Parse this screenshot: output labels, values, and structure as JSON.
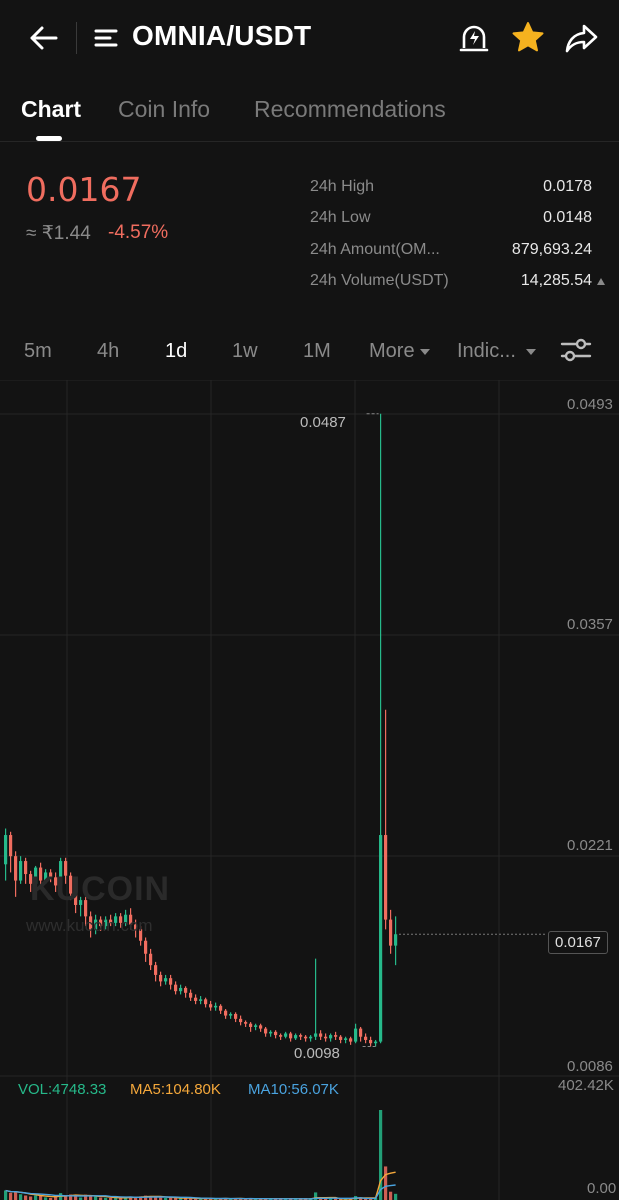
{
  "header": {
    "title": "OMNIA/USDT",
    "icons": [
      "back-arrow-icon",
      "menu-icon",
      "price-alert-icon",
      "star-icon",
      "share-icon"
    ],
    "star_color": "#f5b21f"
  },
  "tabs": [
    {
      "label": "Chart",
      "active": true
    },
    {
      "label": "Coin Info",
      "active": false
    },
    {
      "label": "Recommendations",
      "active": false
    }
  ],
  "price": {
    "last": "0.0167",
    "inr": "≈ ₹1.44",
    "change": "-4.57%",
    "color": "#f06d5f"
  },
  "stats": [
    {
      "label": "24h High",
      "value": "0.0178"
    },
    {
      "label": "24h Low",
      "value": "0.0148"
    },
    {
      "label": "24h Amount(OM...",
      "value": "879,693.24"
    },
    {
      "label": "24h Volume(USDT)",
      "value": "14,285.54"
    }
  ],
  "timeframes": [
    {
      "label": "5m",
      "active": false
    },
    {
      "label": "4h",
      "active": false
    },
    {
      "label": "1d",
      "active": true
    },
    {
      "label": "1w",
      "active": false
    },
    {
      "label": "1M",
      "active": false
    }
  ],
  "more_label": "More",
  "indicators_label": "Indic...",
  "chart_data": {
    "type": "candlestick",
    "y_axis_ticks": [
      "0.0493",
      "0.0357",
      "0.0221",
      "0.0086"
    ],
    "max_marker": "0.0487",
    "min_marker": "0.0098",
    "current_price": "0.0167",
    "watermark": "KUCOIN",
    "watermark_url": "www.kucoin.com",
    "up_color": "#26b98a",
    "down_color": "#f06d5f",
    "candles": [
      [
        0.021,
        0.0228,
        0.0232,
        0.02
      ],
      [
        0.0228,
        0.0215,
        0.023,
        0.0205
      ],
      [
        0.0215,
        0.02,
        0.0218,
        0.019
      ],
      [
        0.02,
        0.0212,
        0.0215,
        0.0198
      ],
      [
        0.0212,
        0.0204,
        0.0214,
        0.0198
      ],
      [
        0.0204,
        0.0198,
        0.0206,
        0.0193
      ],
      [
        0.0198,
        0.0208,
        0.0209,
        0.0197
      ],
      [
        0.0208,
        0.02,
        0.0211,
        0.0196
      ],
      [
        0.02,
        0.0205,
        0.0207,
        0.0198
      ],
      [
        0.0205,
        0.0202,
        0.0207,
        0.0199
      ],
      [
        0.0202,
        0.0197,
        0.0205,
        0.0193
      ],
      [
        0.0197,
        0.0212,
        0.0214,
        0.0195
      ],
      [
        0.0212,
        0.0203,
        0.0214,
        0.0198
      ],
      [
        0.0203,
        0.0192,
        0.0205,
        0.0188
      ],
      [
        0.0192,
        0.0185,
        0.0195,
        0.018
      ],
      [
        0.0185,
        0.0188,
        0.019,
        0.0178
      ],
      [
        0.0188,
        0.0178,
        0.019,
        0.0172
      ],
      [
        0.0178,
        0.017,
        0.0181,
        0.0165
      ],
      [
        0.017,
        0.0176,
        0.0179,
        0.0167
      ],
      [
        0.0176,
        0.0172,
        0.0178,
        0.0169
      ],
      [
        0.0172,
        0.0176,
        0.0178,
        0.017
      ],
      [
        0.0176,
        0.0174,
        0.0179,
        0.0172
      ],
      [
        0.0174,
        0.0178,
        0.018,
        0.0172
      ],
      [
        0.0178,
        0.0174,
        0.018,
        0.0171
      ],
      [
        0.0174,
        0.0179,
        0.0182,
        0.0172
      ],
      [
        0.0179,
        0.0173,
        0.0183,
        0.017
      ],
      [
        0.0173,
        0.017,
        0.0176,
        0.0165
      ],
      [
        0.017,
        0.0163,
        0.0172,
        0.016
      ],
      [
        0.0163,
        0.0155,
        0.0165,
        0.015
      ],
      [
        0.0155,
        0.0148,
        0.0158,
        0.0145
      ],
      [
        0.0148,
        0.0142,
        0.015,
        0.0138
      ],
      [
        0.0142,
        0.0138,
        0.0144,
        0.0135
      ],
      [
        0.0138,
        0.014,
        0.0142,
        0.0136
      ],
      [
        0.014,
        0.0136,
        0.0142,
        0.0133
      ],
      [
        0.0136,
        0.0132,
        0.0138,
        0.013
      ],
      [
        0.0132,
        0.0134,
        0.0136,
        0.013
      ],
      [
        0.0134,
        0.0131,
        0.0135,
        0.0128
      ],
      [
        0.0131,
        0.0128,
        0.0133,
        0.0126
      ],
      [
        0.0128,
        0.0126,
        0.013,
        0.0124
      ],
      [
        0.0126,
        0.0127,
        0.0129,
        0.0124
      ],
      [
        0.0127,
        0.0124,
        0.0128,
        0.0122
      ],
      [
        0.0124,
        0.0122,
        0.0126,
        0.012
      ],
      [
        0.0122,
        0.0123,
        0.0125,
        0.012
      ],
      [
        0.0123,
        0.012,
        0.0124,
        0.0118
      ],
      [
        0.012,
        0.0117,
        0.0121,
        0.0115
      ],
      [
        0.0117,
        0.0118,
        0.0119,
        0.0115
      ],
      [
        0.0118,
        0.0115,
        0.0119,
        0.0113
      ],
      [
        0.0115,
        0.0113,
        0.0117,
        0.0111
      ],
      [
        0.0113,
        0.0112,
        0.0114,
        0.011
      ],
      [
        0.0112,
        0.011,
        0.0113,
        0.0107
      ],
      [
        0.011,
        0.0111,
        0.0112,
        0.0108
      ],
      [
        0.0111,
        0.0109,
        0.0112,
        0.0107
      ],
      [
        0.0109,
        0.0106,
        0.011,
        0.0104
      ],
      [
        0.0106,
        0.0107,
        0.0108,
        0.0104
      ],
      [
        0.0107,
        0.0105,
        0.0108,
        0.0103
      ],
      [
        0.0105,
        0.0104,
        0.0106,
        0.0102
      ],
      [
        0.0104,
        0.0106,
        0.0107,
        0.0103
      ],
      [
        0.0106,
        0.0103,
        0.0107,
        0.0101
      ],
      [
        0.0103,
        0.0105,
        0.0106,
        0.0102
      ],
      [
        0.0105,
        0.0104,
        0.0106,
        0.0102
      ],
      [
        0.0104,
        0.0103,
        0.0105,
        0.0101
      ],
      [
        0.0103,
        0.0104,
        0.0105,
        0.0101
      ],
      [
        0.0104,
        0.0106,
        0.0152,
        0.0102
      ],
      [
        0.0106,
        0.0104,
        0.0108,
        0.0102
      ],
      [
        0.0104,
        0.0103,
        0.0106,
        0.0101
      ],
      [
        0.0103,
        0.0105,
        0.0106,
        0.0101
      ],
      [
        0.0105,
        0.0104,
        0.0107,
        0.0102
      ],
      [
        0.0104,
        0.0102,
        0.0105,
        0.01
      ],
      [
        0.0102,
        0.0103,
        0.0104,
        0.01
      ],
      [
        0.0103,
        0.0101,
        0.0104,
        0.0099
      ],
      [
        0.0101,
        0.0109,
        0.0112,
        0.01
      ],
      [
        0.0109,
        0.0104,
        0.011,
        0.0101
      ],
      [
        0.0104,
        0.0102,
        0.0106,
        0.01
      ],
      [
        0.0102,
        0.01,
        0.0104,
        0.0098
      ],
      [
        0.01,
        0.0101,
        0.0102,
        0.0098
      ],
      [
        0.0101,
        0.0228,
        0.0487,
        0.01
      ],
      [
        0.0228,
        0.0176,
        0.0305,
        0.017
      ],
      [
        0.0176,
        0.016,
        0.0182,
        0.0155
      ],
      [
        0.016,
        0.0167,
        0.0178,
        0.0148
      ]
    ],
    "volume_panel": {
      "max_label": "402.42K",
      "min_label": "0.00",
      "vol_label": "VOL:4748.33",
      "ma5_label": "MA5:104.80K",
      "ma10_label": "MA10:56.07K",
      "vol_color": "#26b98a",
      "ma5_color": "#f5a83b",
      "ma10_color": "#4aa3df"
    }
  }
}
